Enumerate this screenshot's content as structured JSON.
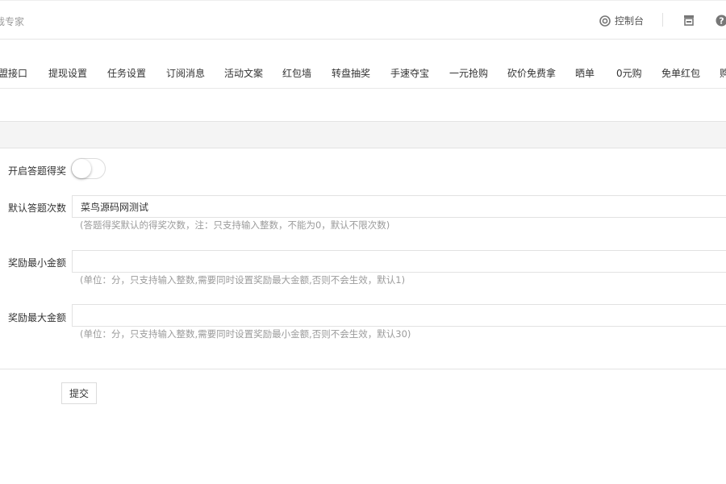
{
  "header": {
    "brand_text": "裁专家",
    "console_label": "控制台",
    "console_icon": "target-icon",
    "store_icon": "store-icon",
    "help_icon": "help-icon"
  },
  "nav": {
    "tabs": [
      {
        "label": "联盟接口"
      },
      {
        "label": "提现设置"
      },
      {
        "label": "任务设置"
      },
      {
        "label": "订阅消息"
      },
      {
        "label": "活动文案"
      },
      {
        "label": "红包墙"
      },
      {
        "label": "转盘抽奖"
      },
      {
        "label": "手速夺宝"
      },
      {
        "label": "一元抢购"
      },
      {
        "label": "砍价免费拿"
      },
      {
        "label": "晒单"
      },
      {
        "label": "0元购"
      },
      {
        "label": "免单红包"
      },
      {
        "label": "购"
      }
    ]
  },
  "form": {
    "enable_label": "开启答题得奖",
    "enable_on": false,
    "default_times_label": "默认答题次数",
    "default_times_value": "菜鸟源码网测试",
    "default_times_help": "(答题得奖默认的得奖次数，注：只支持输入整数，不能为0，默认不限次数)",
    "min_amount_label": "奖励最小金额",
    "min_amount_value": "",
    "min_amount_help": "(单位：分，只支持输入整数,需要同时设置奖励最大金额,否则不会生效，默认1)",
    "max_amount_label": "奖励最大金额",
    "max_amount_value": "",
    "max_amount_help": "(单位：分，只支持输入整数,需要同时设置奖励最小金额,否则不会生效，默认30)",
    "submit_label": "提交"
  }
}
